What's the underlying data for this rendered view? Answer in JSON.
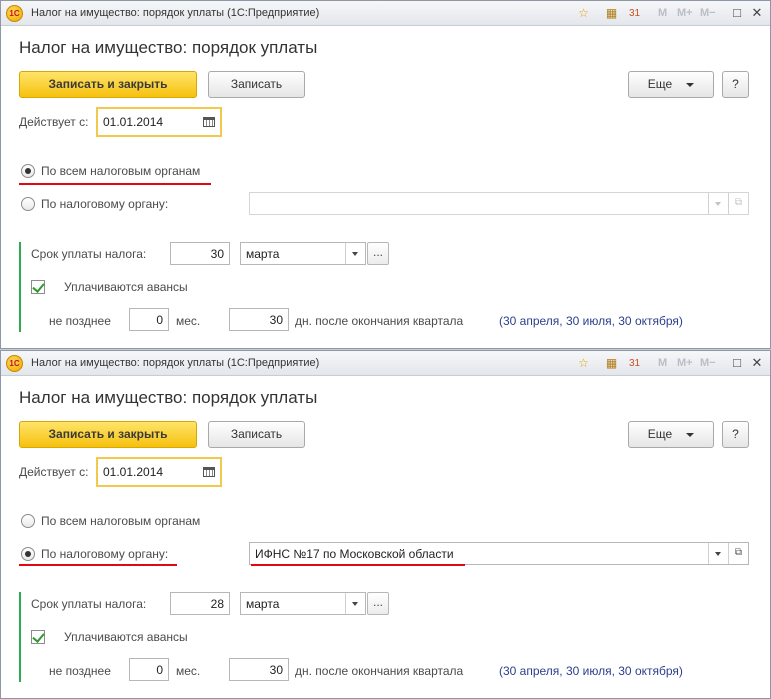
{
  "windows": [
    {
      "title": "Налог на имущество: порядок уплаты  (1С:Предприятие)",
      "form_title": "Налог на имущество: порядок уплаты",
      "toolbar": {
        "write_close": "Записать и закрыть",
        "write": "Записать",
        "more": "Еще",
        "help": "?"
      },
      "titlebar_icons": {
        "m": "M",
        "m_plus": "M+",
        "m_minus": "M−",
        "window_btn": "□",
        "close_btn": "✕"
      },
      "effective_label": "Действует с:",
      "effective_date": "01.01.2014",
      "radio_all_label": "По всем налоговым органам",
      "radio_one_label": "По налоговому органу:",
      "selected_radio": "all",
      "tax_authority_value": "",
      "deadline_label": "Срок уплаты налога:",
      "deadline_day": "30",
      "deadline_month": "марта",
      "dots": "...",
      "advances_label": "Уплачиваются авансы",
      "advances_checked": true,
      "not_later_label": "не позднее",
      "months_value": "0",
      "months_label": "мес.",
      "days_value": "30",
      "days_label": "дн. после окончания квартала",
      "dates_hint": "(30 апреля, 30 июля, 30 октября)"
    },
    {
      "title": "Налог на имущество: порядок уплаты  (1С:Предприятие)",
      "form_title": "Налог на имущество: порядок уплаты",
      "toolbar": {
        "write_close": "Записать и закрыть",
        "write": "Записать",
        "more": "Еще",
        "help": "?"
      },
      "titlebar_icons": {
        "m": "M",
        "m_plus": "M+",
        "m_minus": "M−",
        "window_btn": "□",
        "close_btn": "✕"
      },
      "effective_label": "Действует с:",
      "effective_date": "01.01.2014",
      "radio_all_label": "По всем налоговым органам",
      "radio_one_label": "По налоговому органу:",
      "selected_radio": "one",
      "tax_authority_value": "ИФНС №17 по Московской области",
      "deadline_label": "Срок уплаты налога:",
      "deadline_day": "28",
      "deadline_month": "марта",
      "dots": "...",
      "advances_label": "Уплачиваются авансы",
      "advances_checked": true,
      "not_later_label": "не позднее",
      "months_value": "0",
      "months_label": "мес.",
      "days_value": "30",
      "days_label": "дн. после окончания квартала",
      "dates_hint": "(30 апреля, 30 июля, 30 октября)"
    }
  ],
  "colors": {
    "primary_button": "#f6c10e",
    "highlight_underline": "#e30613",
    "group_bar": "#2fa84f",
    "hint_text": "#2b3f8c"
  }
}
